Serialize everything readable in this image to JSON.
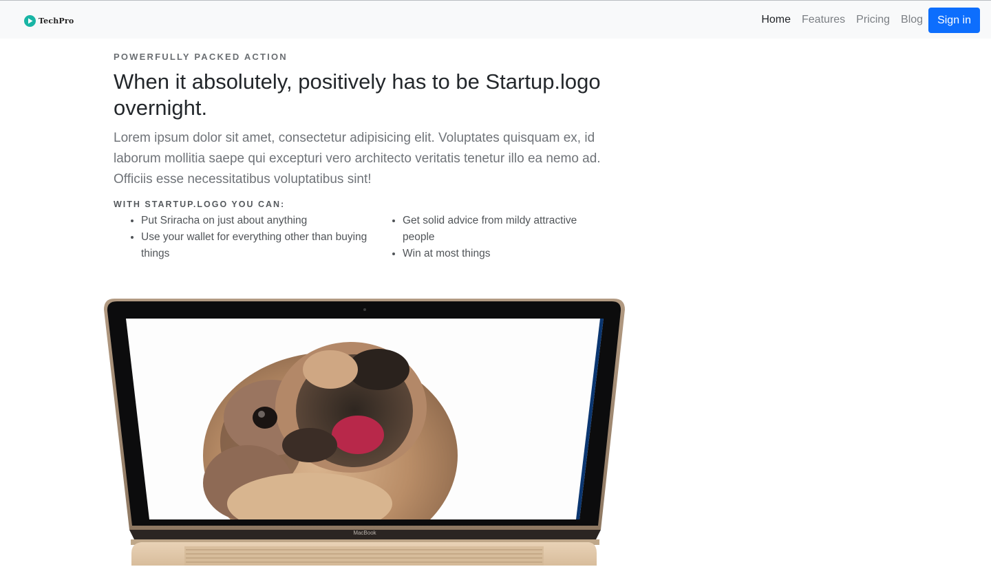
{
  "brand": {
    "name": "TechPro",
    "icon": "play-circle-icon",
    "accent": "#19b5a5"
  },
  "nav": {
    "items": [
      {
        "label": "Home",
        "active": true
      },
      {
        "label": "Features",
        "active": false
      },
      {
        "label": "Pricing",
        "active": false
      },
      {
        "label": "Blog",
        "active": false
      }
    ],
    "signin_label": "Sign in",
    "signin_color": "#0d6efd"
  },
  "hero": {
    "eyebrow": "POWERFULLY PACKED ACTION",
    "title": "When it absolutely, positively has to be Startup.logo overnight.",
    "lead": "Lorem ipsum dolor sit amet, consectetur adipisicing elit. Voluptates quisquam ex, id laborum mollitia saepe qui excepturi vero architecto veritatis tenetur illo ea nemo ad. Officiis esse necessitatibus voluptatibus sint!",
    "features_heading": "WITH STARTUP.LOGO YOU CAN:",
    "features_left": [
      "Put Sriracha on just about anything",
      "Use your wallet for everything other than buying things"
    ],
    "features_right": [
      "Get solid advice from mildy attractive people",
      "Win at most things"
    ]
  },
  "device": {
    "label": "MacBook",
    "screen_image": "pug-photo"
  }
}
